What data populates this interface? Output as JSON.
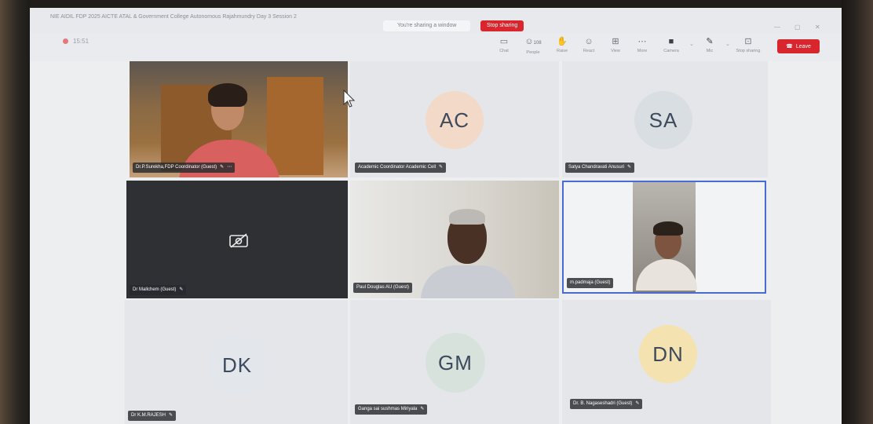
{
  "window": {
    "title": "NIE AIDIL FDP 2025 AICTE ATAL & Government College Autonomous Rajahmundry Day 3 Session 2",
    "sharing_notice": "You're sharing a window",
    "stop_sharing": "Stop sharing"
  },
  "meeting": {
    "timer": "15:51",
    "participant_count": "108"
  },
  "toolbar": {
    "chat": "Chat",
    "people": "People",
    "raise": "Raise",
    "react": "React",
    "view": "View",
    "more": "More",
    "camera": "Camera",
    "mic": "Mic",
    "stop_sharing": "Stop sharing",
    "leave": "Leave"
  },
  "participants": [
    {
      "name": "Dr.P.Surekha,FDP Coordinator (Guest)"
    },
    {
      "initials": "AC",
      "name": "Academic Coordinator Academic Cell",
      "avatar_color": "#f3d9c7"
    },
    {
      "initials": "SA",
      "name": "Satya Chandravati Anusuri",
      "avatar_color": "#d9dee2"
    },
    {
      "name": "Dr Mallchem (Guest)"
    },
    {
      "name": "Paul Douglas AU (Guest)"
    },
    {
      "name": "m.padmaja (Guest)"
    },
    {
      "initials": "DK",
      "name": "Dr K.M.RAJESH",
      "avatar_color": "#e3e6ea"
    },
    {
      "initials": "GM",
      "name": "Ganga sai sushmas Miriyala",
      "avatar_color": "#d8e2dc"
    },
    {
      "initials": "DN",
      "name": "Dr. B. Nagaseshadri (Guest)",
      "avatar_color": "#f4e2b0"
    }
  ],
  "colors": {
    "accent": "#d9262e",
    "selected": "#4a6bd6"
  }
}
